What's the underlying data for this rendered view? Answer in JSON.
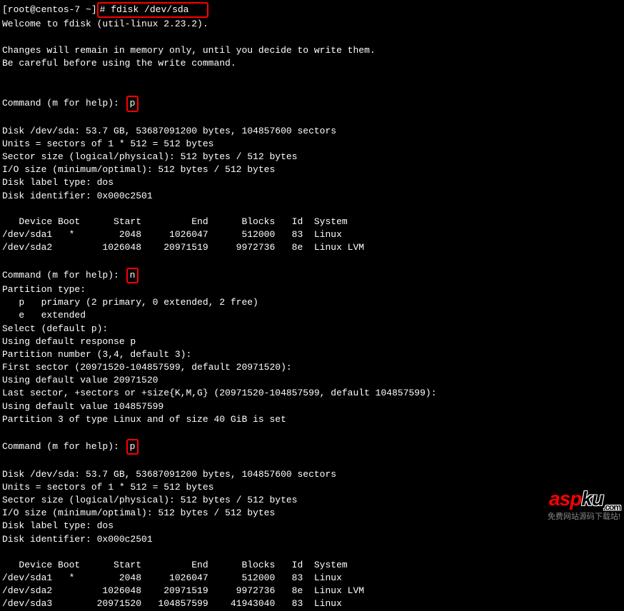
{
  "prompt": {
    "user_host": "[root@centos-7 ~]",
    "hash": "#",
    "command": "fdisk /dev/sda   "
  },
  "welcome": "Welcome to fdisk (util-linux 2.23.2).",
  "warning_line1": "Changes will remain in memory only, until you decide to write them.",
  "warning_line2": "Be careful before using the write command.",
  "cmd_prompt": "Command (m for help): ",
  "cmd_p1": "p",
  "cmd_n": "n",
  "cmd_p2": "p",
  "disk_info": {
    "header": "Disk /dev/sda: 53.7 GB, 53687091200 bytes, 104857600 sectors",
    "units": "Units = sectors of 1 * 512 = 512 bytes",
    "sector_size": "Sector size (logical/physical): 512 bytes / 512 bytes",
    "io_size": "I/O size (minimum/optimal): 512 bytes / 512 bytes",
    "label_type": "Disk label type: dos",
    "identifier": "Disk identifier: 0x000c2501"
  },
  "table1": {
    "header": "   Device Boot      Start         End      Blocks   Id  System",
    "row1": "/dev/sda1   *        2048     1026047      512000   83  Linux",
    "row2": "/dev/sda2         1026048    20971519     9972736   8e  Linux LVM"
  },
  "partition_create": {
    "type_label": "Partition type:",
    "primary": "   p   primary (2 primary, 0 extended, 2 free)",
    "extended": "   e   extended",
    "select": "Select (default p):",
    "default_resp": "Using default response p",
    "number": "Partition number (3,4, default 3):",
    "first_sector": "First sector (20971520-104857599, default 20971520):",
    "default_first": "Using default value 20971520",
    "last_sector": "Last sector, +sectors or +size{K,M,G} (20971520-104857599, default 104857599):",
    "default_last": "Using default value 104857599",
    "result": "Partition 3 of type Linux and of size 40 GiB is set"
  },
  "table2": {
    "header": "   Device Boot      Start         End      Blocks   Id  System",
    "row1": "/dev/sda1   *        2048     1026047      512000   83  Linux",
    "row2": "/dev/sda2         1026048    20971519     9972736   8e  Linux LVM",
    "row3": "/dev/sda3        20971520   104857599    41943040   83  Linux"
  },
  "watermark": {
    "brand_red": "asp",
    "brand_black": "ku",
    "brand_com": ".com",
    "tagline": "免费网站源码下载站!"
  }
}
